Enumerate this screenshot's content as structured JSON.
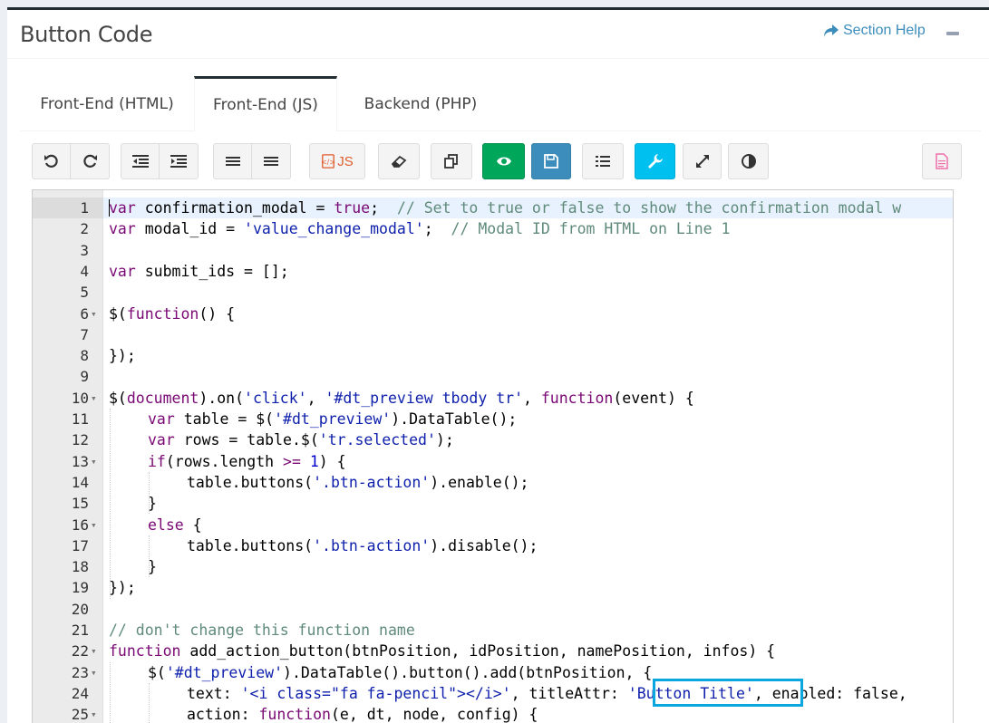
{
  "header": {
    "title": "Button Code",
    "help_label": "Section Help"
  },
  "tabs": [
    {
      "label": "Front-End (HTML)",
      "active": false
    },
    {
      "label": "Front-End (JS)",
      "active": true
    },
    {
      "label": "Backend (PHP)",
      "active": false
    }
  ],
  "toolbar": {
    "js_label": "JS",
    "icons": [
      "undo-icon",
      "redo-icon",
      "outdent-icon",
      "indent-icon",
      "align-icon",
      "align-justify-icon",
      "js-file-icon",
      "eraser-icon",
      "copy-icon",
      "eye-icon",
      "save-icon",
      "list-icon",
      "wrench-icon",
      "expand-icon",
      "contrast-icon",
      "file-icon"
    ]
  },
  "colors": {
    "green": "#00a65a",
    "blue": "#3c8dbc",
    "aqua": "#00c0ef",
    "highlight": "#0aa6e0"
  },
  "code_lines": [
    {
      "n": "1",
      "fold": ""
    },
    {
      "n": "2",
      "fold": ""
    },
    {
      "n": "3",
      "fold": ""
    },
    {
      "n": "4",
      "fold": ""
    },
    {
      "n": "5",
      "fold": ""
    },
    {
      "n": "6",
      "fold": "▾"
    },
    {
      "n": "7",
      "fold": ""
    },
    {
      "n": "8",
      "fold": ""
    },
    {
      "n": "9",
      "fold": ""
    },
    {
      "n": "10",
      "fold": "▾"
    },
    {
      "n": "11",
      "fold": ""
    },
    {
      "n": "12",
      "fold": ""
    },
    {
      "n": "13",
      "fold": "▾"
    },
    {
      "n": "14",
      "fold": ""
    },
    {
      "n": "15",
      "fold": ""
    },
    {
      "n": "16",
      "fold": "▾"
    },
    {
      "n": "17",
      "fold": ""
    },
    {
      "n": "18",
      "fold": ""
    },
    {
      "n": "19",
      "fold": ""
    },
    {
      "n": "20",
      "fold": ""
    },
    {
      "n": "21",
      "fold": ""
    },
    {
      "n": "22",
      "fold": "▾"
    },
    {
      "n": "23",
      "fold": "▾"
    },
    {
      "n": "24",
      "fold": ""
    },
    {
      "n": "25",
      "fold": "▾"
    }
  ],
  "code": {
    "l1_kw": "var",
    "l1_rest": " confirmation_modal = ",
    "l1_true": "true",
    "l1_semi": ";  ",
    "l1_cm": "// Set to true or false to show the confirmation modal w",
    "l2_kw": "var",
    "l2_rest": " modal_id = ",
    "l2_str": "'value_change_modal'",
    "l2_semi": ";  ",
    "l2_cm": "// Modal ID from HTML on Line 1",
    "l4_kw": "var",
    "l4_rest": " submit_ids = [];",
    "l6_a": "$(",
    "l6_kw": "function",
    "l6_b": "() {",
    "l8": "});",
    "l10_a": "$(",
    "l10_kw1": "document",
    "l10_b": ").on(",
    "l10_s1": "'click'",
    "l10_c": ", ",
    "l10_s2": "'#dt_preview tbody tr'",
    "l10_d": ", ",
    "l10_kw2": "function",
    "l10_e": "(event) {",
    "l11_kw": "var",
    "l11_a": " table = $(",
    "l11_s": "'#dt_preview'",
    "l11_b": ").DataTable();",
    "l12_kw": "var",
    "l12_a": " rows = table.$(",
    "l12_s": "'tr.selected'",
    "l12_b": ");",
    "l13_kw": "if",
    "l13_a": "(rows.length ",
    "l13_op": ">=",
    "l13_b": " ",
    "l13_num": "1",
    "l13_c": ") {",
    "l14_a": "table.buttons(",
    "l14_s": "'.btn-action'",
    "l14_b": ").enable();",
    "l15": "}",
    "l16_kw": "else",
    "l16_a": " {",
    "l17_a": "table.buttons(",
    "l17_s": "'.btn-action'",
    "l17_b": ").disable();",
    "l18": "}",
    "l19": "});",
    "l21_cm": "// don't change this function name",
    "l22_kw": "function",
    "l22_a": " add_action_button(btnPosition, idPosition, namePosition, infos) {",
    "l23_a": "$(",
    "l23_s": "'#dt_preview'",
    "l23_b": ").DataTable().button().add(btnPosition, {",
    "l24_a": "text: ",
    "l24_s": "'<i class=\"fa fa-pencil\"></i>'",
    "l24_b": ", titleAttr: ",
    "l24_s2": "'Button Title'",
    "l24_c": ", enabled: false,",
    "l25_a": "action: ",
    "l25_kw": "function",
    "l25_b": "(e, dt, node, config) {"
  }
}
